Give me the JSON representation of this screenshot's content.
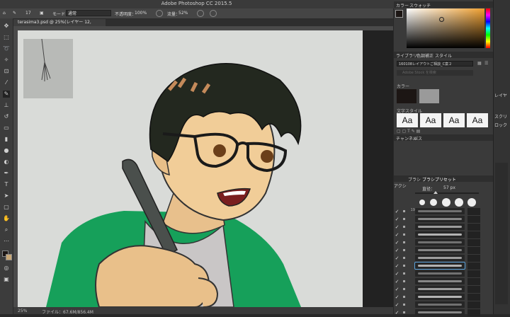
{
  "window": {
    "title": "Adobe Photoshop CC 2015.5"
  },
  "options_bar": {
    "brush_size": "17",
    "mode_label": "モード：",
    "mode_value": "通常",
    "opacity_label": "不透明度：",
    "opacity_value": "100%",
    "flow_label": "流量：",
    "flow_value": "52%",
    "workspace": "初期設定"
  },
  "document": {
    "tab_title": "terasima3.psd @ 25%(レイヤー 12, RGB/8) *"
  },
  "status": {
    "zoom": "25%",
    "file_info": "ファイル：67.6M/856.4M"
  },
  "panels": {
    "color_tabs": [
      "カラー",
      "スウォッチ"
    ],
    "library_tabs": [
      "ライブラリ",
      "色調補正",
      "スタイル"
    ],
    "library_select": "160108レイアウトご相談_C案２",
    "search_placeholder": "Adobe Stock を検索",
    "color_section": "カラー",
    "char_style_section": "文字スタイル",
    "char_styles": [
      "Aa",
      "Aa",
      "Aa",
      "Aa"
    ],
    "channel_tabs": [
      "チャンネル",
      "パス"
    ],
    "brush_tabs": [
      "ブラシ",
      "ブラシプリセット"
    ],
    "brush_size_label": "直径：",
    "brush_size_value": "57 px",
    "layers_label": "アクシ",
    "brush_counts": [
      "19",
      "",
      "",
      "",
      "",
      "",
      "",
      "",
      "",
      "",
      "",
      "",
      "",
      ""
    ],
    "right_edge": [
      "レイヤ",
      "スクリ",
      "ロック"
    ]
  },
  "colors": {
    "accent": "#f0a030",
    "fg_swatch": "#1c1614",
    "bg_swatch": "#9a9a9a"
  }
}
